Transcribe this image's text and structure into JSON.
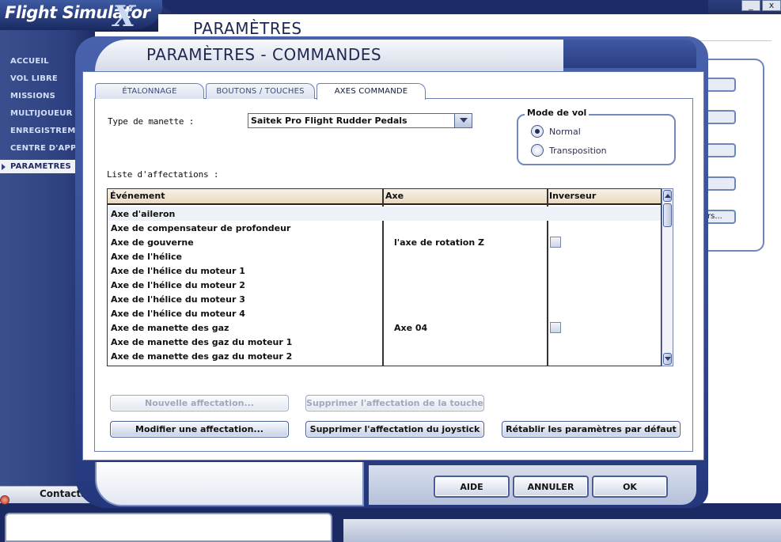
{
  "app": {
    "logo_text": "Flight Simulator",
    "logo_x": "X",
    "page_title": "PARAMÈTRES",
    "window_controls": [
      "_",
      "x"
    ]
  },
  "leftnav": {
    "items": [
      {
        "label": "ACCUEIL"
      },
      {
        "label": "VOL LIBRE"
      },
      {
        "label": "MISSIONS"
      },
      {
        "label": "MULTIJOUEUR"
      },
      {
        "label": "ENREGISTREMENTS"
      },
      {
        "label": "CENTRE D'APPRENTISSAGE"
      },
      {
        "label": "PARAMÈTRES"
      }
    ],
    "active_index": 6
  },
  "background": {
    "right_button_label": "rs...",
    "contacts_label": "Contacts"
  },
  "dialog": {
    "title": "PARAMÈTRES - COMMANDES",
    "tabs": [
      {
        "label": "ÉTALONNAGE"
      },
      {
        "label": "BOUTONS / TOUCHES"
      },
      {
        "label": "AXES COMMANDE"
      }
    ],
    "active_tab": 2,
    "controller_type_label": "Type de manette :",
    "controller_type_value": "Saitek Pro Flight Rudder Pedals",
    "flight_mode": {
      "legend": "Mode de vol",
      "options": [
        {
          "label": "Normal",
          "checked": true
        },
        {
          "label": "Transposition",
          "checked": false
        }
      ]
    },
    "assignments_label": "Liste d'affectations :",
    "columns": [
      "Événement",
      "Axe",
      "Inverseur"
    ],
    "rows": [
      {
        "event": "Axe d'aileron",
        "axis": "",
        "has_checkbox": false
      },
      {
        "event": "Axe de compensateur de profondeur",
        "axis": "",
        "has_checkbox": false
      },
      {
        "event": "Axe de gouverne",
        "axis": "l'axe de rotation Z",
        "has_checkbox": true
      },
      {
        "event": "Axe de l'hélice",
        "axis": "",
        "has_checkbox": false
      },
      {
        "event": "Axe de l'hélice du moteur 1",
        "axis": "",
        "has_checkbox": false
      },
      {
        "event": "Axe de l'hélice du moteur 2",
        "axis": "",
        "has_checkbox": false
      },
      {
        "event": "Axe de l'hélice du moteur 3",
        "axis": "",
        "has_checkbox": false
      },
      {
        "event": "Axe de l'hélice du moteur 4",
        "axis": "",
        "has_checkbox": false
      },
      {
        "event": "Axe de manette des gaz",
        "axis": "Axe 04",
        "has_checkbox": true
      },
      {
        "event": "Axe de manette des gaz du moteur 1",
        "axis": "",
        "has_checkbox": false
      },
      {
        "event": "Axe de manette des gaz du moteur 2",
        "axis": "",
        "has_checkbox": false
      }
    ],
    "buttons": {
      "new_assignment": "Nouvelle affectation...",
      "delete_key_assignment": "Supprimer l'affectation de la touche",
      "modify_assignment": "Modifier une affectation...",
      "delete_joystick_assignment": "Supprimer l'affectation du joystick",
      "restore_defaults": "Rétablir les paramètres par défaut",
      "help": "AIDE",
      "cancel": "ANNULER",
      "ok": "OK"
    }
  }
}
